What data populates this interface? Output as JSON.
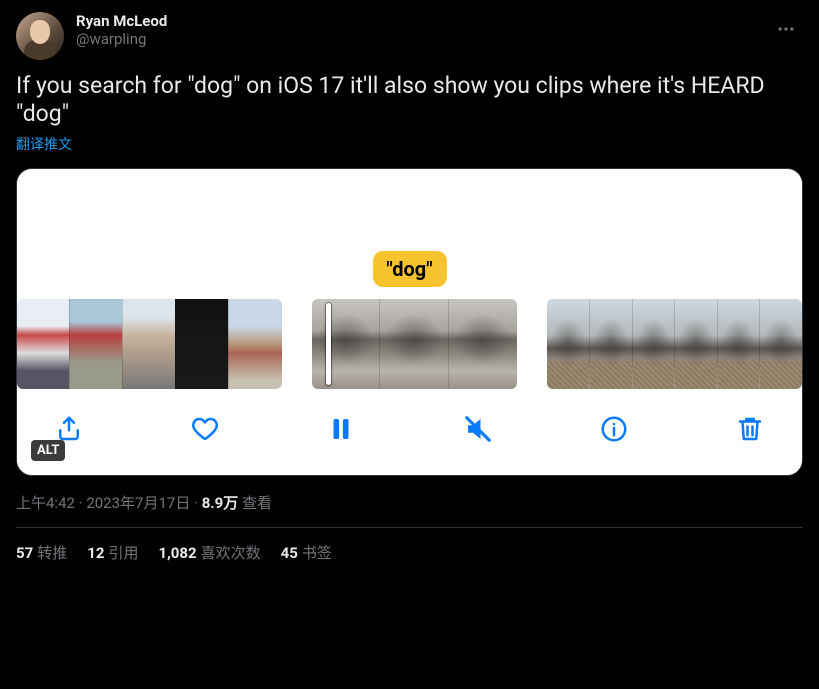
{
  "author": {
    "display_name": "Ryan McLeod",
    "handle": "@warpling"
  },
  "tweet_text": "If you search for \"dog\" on iOS 17 it'll also show you clips where it's HEARD \"dog\"",
  "translate_label": "翻译推文",
  "media": {
    "search_term_label": "\"dog\"",
    "alt_badge": "ALT"
  },
  "meta": {
    "time": "上午4:42",
    "sep1": " · ",
    "date": "2023年7月17日",
    "sep2": " · ",
    "views_count": "8.9万",
    "views_label": " 查看"
  },
  "stats": {
    "retweets": {
      "count": "57",
      "label": "转推"
    },
    "quotes": {
      "count": "12",
      "label": "引用"
    },
    "likes": {
      "count": "1,082",
      "label": "喜欢次数"
    },
    "bookmarks": {
      "count": "45",
      "label": "书签"
    }
  }
}
